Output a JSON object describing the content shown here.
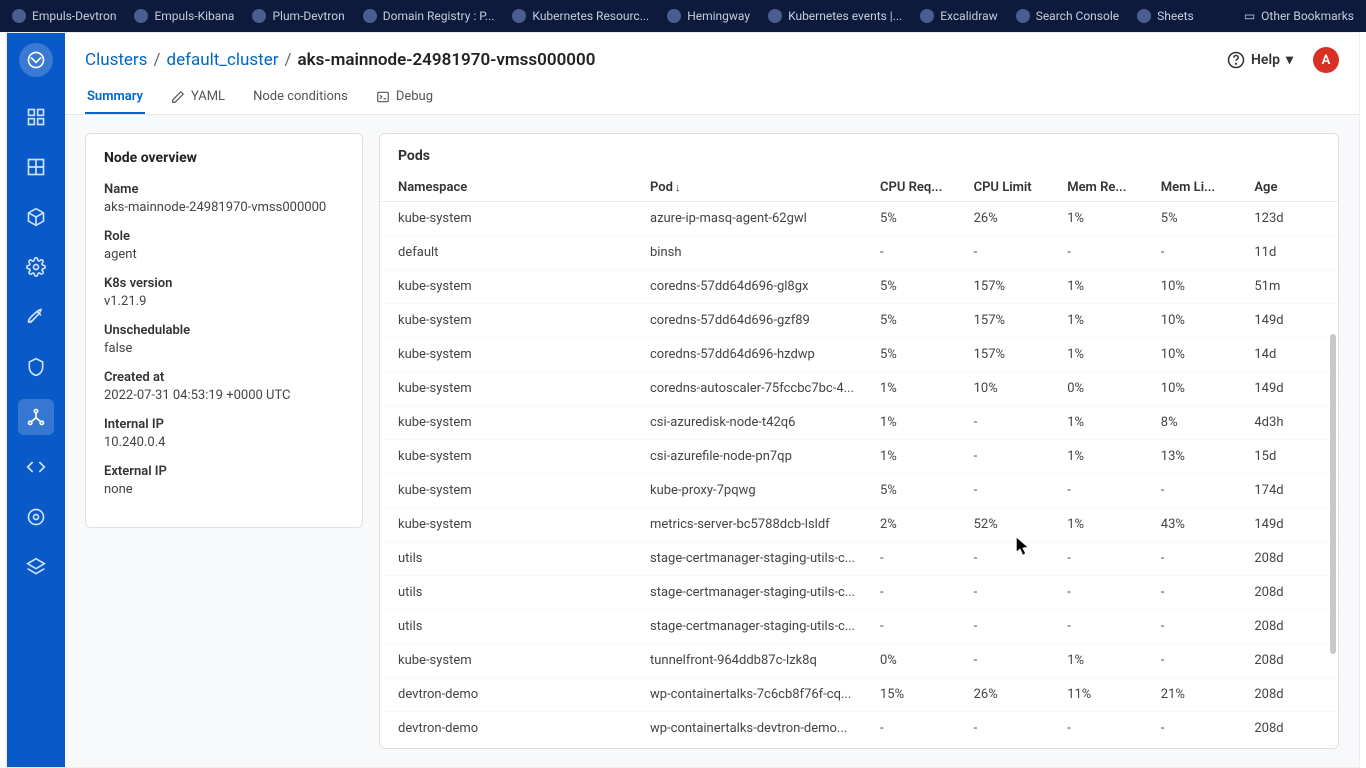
{
  "bookmarks": {
    "items": [
      "Empuls-Devtron",
      "Empuls-Kibana",
      "Plum-Devtron",
      "Domain Registry : P...",
      "Kubernetes Resourc...",
      "Hemingway",
      "Kubernetes events |...",
      "Excalidraw",
      "Search Console",
      "Sheets"
    ],
    "other": "Other Bookmarks"
  },
  "breadcrumb": {
    "root": "Clusters",
    "cluster": "default_cluster",
    "node": "aks-mainnode-24981970-vmss000000"
  },
  "help_label": "Help",
  "avatar_letter": "A",
  "tabs": {
    "summary": "Summary",
    "yaml": "YAML",
    "conditions": "Node conditions",
    "debug": "Debug"
  },
  "overview": {
    "title": "Node overview",
    "rows": {
      "name": {
        "label": "Name",
        "value": "aks-mainnode-24981970-vmss000000"
      },
      "role": {
        "label": "Role",
        "value": "agent"
      },
      "k8s": {
        "label": "K8s version",
        "value": "v1.21.9"
      },
      "unsched": {
        "label": "Unschedulable",
        "value": "false"
      },
      "created": {
        "label": "Created at",
        "value": "2022-07-31 04:53:19 +0000 UTC"
      },
      "intip": {
        "label": "Internal IP",
        "value": "10.240.0.4"
      },
      "extip": {
        "label": "External IP",
        "value": "none"
      }
    }
  },
  "pods": {
    "title": "Pods",
    "headers": {
      "ns": "Namespace",
      "pod": "Pod",
      "cpureq": "CPU Req...",
      "cpulim": "CPU Limit",
      "memreq": "Mem Re...",
      "memlim": "Mem Li...",
      "age": "Age"
    },
    "rows": [
      {
        "ns": "kube-system",
        "pod": "azure-ip-masq-agent-62gwl",
        "cpureq": "5%",
        "cpulim": "26%",
        "memreq": "1%",
        "memlim": "5%",
        "age": "123d"
      },
      {
        "ns": "default",
        "pod": "binsh",
        "cpureq": "-",
        "cpulim": "-",
        "memreq": "-",
        "memlim": "-",
        "age": "11d"
      },
      {
        "ns": "kube-system",
        "pod": "coredns-57dd64d696-gl8gx",
        "cpureq": "5%",
        "cpulim": "157%",
        "memreq": "1%",
        "memlim": "10%",
        "age": "51m"
      },
      {
        "ns": "kube-system",
        "pod": "coredns-57dd64d696-gzf89",
        "cpureq": "5%",
        "cpulim": "157%",
        "memreq": "1%",
        "memlim": "10%",
        "age": "149d"
      },
      {
        "ns": "kube-system",
        "pod": "coredns-57dd64d696-hzdwp",
        "cpureq": "5%",
        "cpulim": "157%",
        "memreq": "1%",
        "memlim": "10%",
        "age": "14d"
      },
      {
        "ns": "kube-system",
        "pod": "coredns-autoscaler-75fccbc7bc-4...",
        "cpureq": "1%",
        "cpulim": "10%",
        "memreq": "0%",
        "memlim": "10%",
        "age": "149d"
      },
      {
        "ns": "kube-system",
        "pod": "csi-azuredisk-node-t42q6",
        "cpureq": "1%",
        "cpulim": "-",
        "memreq": "1%",
        "memlim": "8%",
        "age": "4d3h"
      },
      {
        "ns": "kube-system",
        "pod": "csi-azurefile-node-pn7qp",
        "cpureq": "1%",
        "cpulim": "-",
        "memreq": "1%",
        "memlim": "13%",
        "age": "15d"
      },
      {
        "ns": "kube-system",
        "pod": "kube-proxy-7pqwg",
        "cpureq": "5%",
        "cpulim": "-",
        "memreq": "-",
        "memlim": "-",
        "age": "174d"
      },
      {
        "ns": "kube-system",
        "pod": "metrics-server-bc5788dcb-lsldf",
        "cpureq": "2%",
        "cpulim": "52%",
        "memreq": "1%",
        "memlim": "43%",
        "age": "149d"
      },
      {
        "ns": "utils",
        "pod": "stage-certmanager-staging-utils-c...",
        "cpureq": "-",
        "cpulim": "-",
        "memreq": "-",
        "memlim": "-",
        "age": "208d"
      },
      {
        "ns": "utils",
        "pod": "stage-certmanager-staging-utils-c...",
        "cpureq": "-",
        "cpulim": "-",
        "memreq": "-",
        "memlim": "-",
        "age": "208d"
      },
      {
        "ns": "utils",
        "pod": "stage-certmanager-staging-utils-c...",
        "cpureq": "-",
        "cpulim": "-",
        "memreq": "-",
        "memlim": "-",
        "age": "208d"
      },
      {
        "ns": "kube-system",
        "pod": "tunnelfront-964ddb87c-lzk8q",
        "cpureq": "0%",
        "cpulim": "-",
        "memreq": "1%",
        "memlim": "-",
        "age": "208d"
      },
      {
        "ns": "devtron-demo",
        "pod": "wp-containertalks-7c6cb8f76f-cq...",
        "cpureq": "15%",
        "cpulim": "26%",
        "memreq": "11%",
        "memlim": "21%",
        "age": "208d"
      },
      {
        "ns": "devtron-demo",
        "pod": "wp-containertalks-devtron-demo...",
        "cpureq": "-",
        "cpulim": "-",
        "memreq": "-",
        "memlim": "-",
        "age": "208d"
      }
    ]
  }
}
